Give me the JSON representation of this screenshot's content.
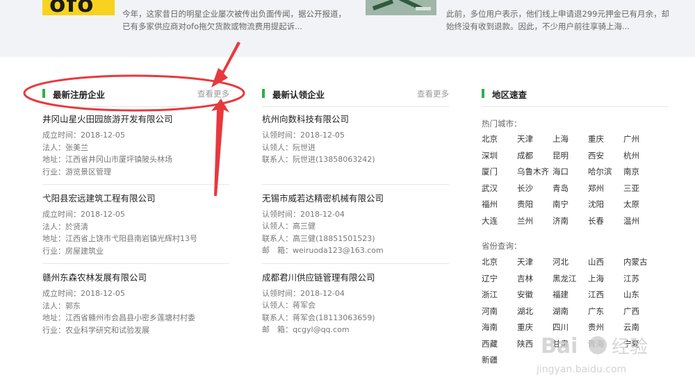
{
  "news": [
    {
      "logo_text": "ofo",
      "lines": [
        "今年，这家昔日的明星企业屡次被传出负面传闻，据公开报道，",
        "已有多家供应商对ofo拖欠货款或物流费用提起诉..."
      ]
    },
    {
      "lines": [
        "此前，多位用户表示，他们线上申请退299元押金已有月余，却",
        "始终没有收到退款。因此，不少用户前往享骑上海..."
      ]
    }
  ],
  "registered": {
    "title": "最新注册企业",
    "more": "查看更多",
    "items": [
      {
        "name": "井冈山星火田园旅游开发有限公司",
        "meta": [
          "成立时间：2018-12-05",
          "法人：张美兰",
          "地址：江西省井冈山市厦坪镇陂头林场",
          "行业：游览景区管理"
        ]
      },
      {
        "name": "弋阳县宏远建筑工程有限公司",
        "meta": [
          "成立时间：2018-12-05",
          "法人：於贤清",
          "地址：江西省上饶市弋阳县南岩镇光辉村13号",
          "行业：房屋建筑业"
        ]
      },
      {
        "name": "赣州东森农林发展有限公司",
        "meta": [
          "成立时间：2018-12-05",
          "法人：郭东",
          "地址：江西省赣州市会昌县小密乡莲塘村村委",
          "行业：农业科学研究和试验发展"
        ]
      }
    ]
  },
  "certified": {
    "title": "最新认领企业",
    "more": "查看更多",
    "items": [
      {
        "name": "杭州向数科技有限公司",
        "meta": [
          "认领时间：2018-12-05",
          "认领人：阮世进",
          "联系人：阮世进(13858063242)"
        ]
      },
      {
        "name": "无锡市威若达精密机械有限公司",
        "meta": [
          "认领时间：2018-12-04",
          "认领人：高三健",
          "联系人：高三健(18851501523)",
          "邮　箱：weiruoda123@163.com"
        ]
      },
      {
        "name": "成都君川供应链管理有限公司",
        "meta": [
          "认领时间：2018-12-04",
          "认领人：蒋军会",
          "联系人：蒋军会(18113063659)",
          "邮　箱：qcgyl@qq.com"
        ]
      }
    ]
  },
  "region": {
    "title": "地区速查",
    "hot_label": "热门城市：",
    "hot": [
      "北京",
      "天津",
      "上海",
      "重庆",
      "广州",
      "深圳",
      "成都",
      "昆明",
      "西安",
      "杭州",
      "厦门",
      "乌鲁木齐",
      "海口",
      "哈尔滨",
      "南京",
      "武汉",
      "长沙",
      "青岛",
      "郑州",
      "三亚",
      "福州",
      "贵阳",
      "南宁",
      "沈阳",
      "太原",
      "大连",
      "兰州",
      "济南",
      "长春",
      "温州"
    ],
    "prov_label": "省份查询：",
    "provinces": [
      "北京",
      "天津",
      "河北",
      "山西",
      "内蒙古",
      "辽宁",
      "吉林",
      "黑龙江",
      "上海",
      "江苏",
      "浙江",
      "安徽",
      "福建",
      "江西",
      "山东",
      "河南",
      "湖北",
      "湖南",
      "广东",
      "广西",
      "海南",
      "重庆",
      "四川",
      "贵州",
      "云南",
      "西藏",
      "陕西",
      "甘肃",
      "青海",
      "宁夏",
      "新疆"
    ]
  },
  "colors": {
    "accent": "#2bb24c",
    "annotation": "#e8383d"
  }
}
